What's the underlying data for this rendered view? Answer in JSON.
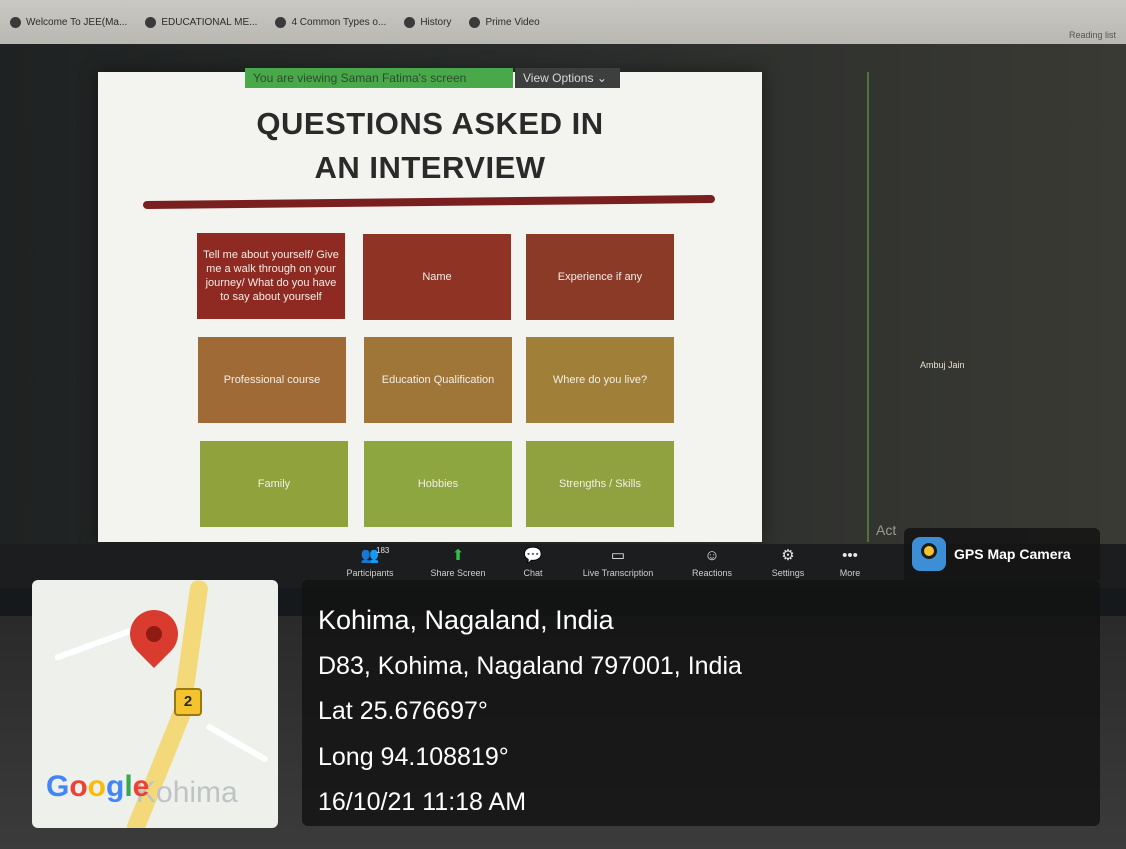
{
  "browser": {
    "bookmarks": [
      "Welcome To JEE(Ma...",
      "EDUCATIONAL ME...",
      "4 Common Types o...",
      "History",
      "Prime Video"
    ],
    "reading_list": "Reading list"
  },
  "zoom": {
    "viewing_banner": "You are viewing Saman Fatima's screen",
    "view_options": "View Options",
    "participant_name": "Ambuj Jain",
    "partial_text": "Act",
    "toolbar": {
      "participants_count": "183",
      "buttons": [
        "Participants",
        "Share Screen",
        "Chat",
        "Live Transcription",
        "Reactions",
        "Settings",
        "More"
      ]
    }
  },
  "slide": {
    "title": "QUESTIONS ASKED IN AN INTERVIEW",
    "tiles": [
      {
        "text": "Tell me about yourself/ Give me a walk through on your journey/ What do you have to say about yourself",
        "color": "#8e2a22"
      },
      {
        "text": "Name",
        "color": "#8f3325"
      },
      {
        "text": "Experience if any",
        "color": "#8c3a28"
      },
      {
        "text": "Professional course",
        "color": "#a06a37"
      },
      {
        "text": "Education Qualification",
        "color": "#9f7538"
      },
      {
        "text": "Where do you live?",
        "color": "#a08039"
      },
      {
        "text": "Family",
        "color": "#8fa23c"
      },
      {
        "text": "Hobbies",
        "color": "#8ea63f"
      },
      {
        "text": "Strengths / Skills",
        "color": "#90a240"
      }
    ]
  },
  "gps": {
    "app_name": "GPS Map Camera",
    "location_title": "Kohima, Nagaland, India",
    "address": "D83, Kohima, Nagaland 797001, India",
    "lat": "Lat 25.676697°",
    "long": "Long 94.108819°",
    "datetime": "16/10/21 11:18 AM",
    "map": {
      "road_shield": "2",
      "provider": "Google",
      "place_label": "Kohima"
    }
  }
}
